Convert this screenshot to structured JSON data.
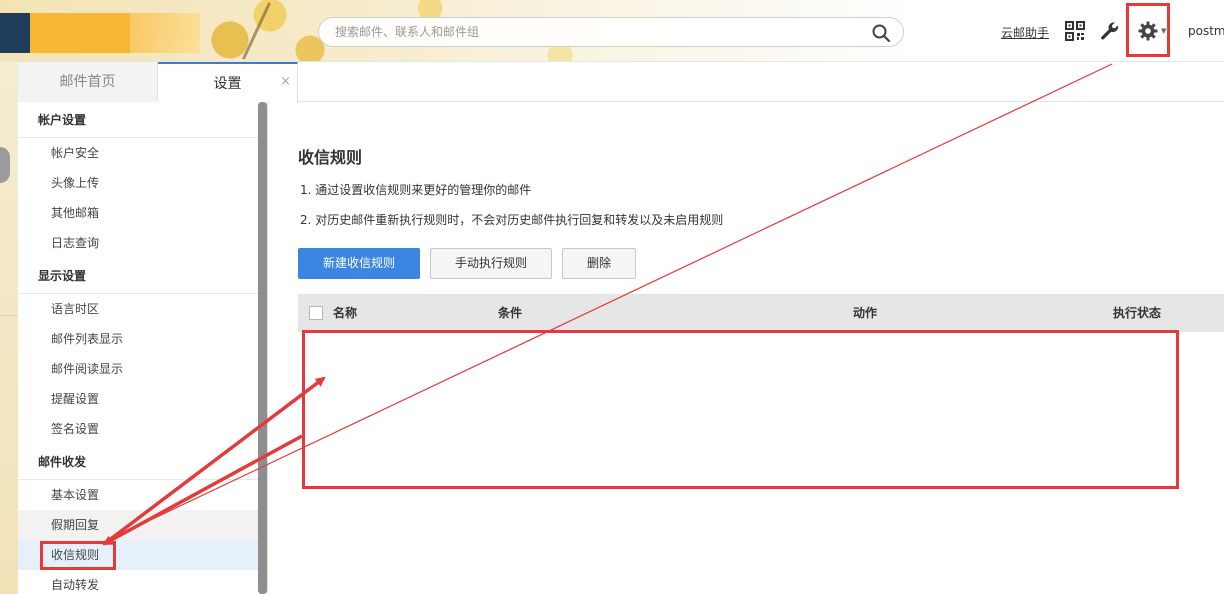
{
  "header": {
    "search_placeholder": "搜索邮件、联系人和邮件组",
    "helper_link": "云邮助手",
    "username": "postma"
  },
  "tabs": [
    {
      "label": "邮件首页"
    },
    {
      "label": "设置",
      "close": "×"
    }
  ],
  "sidebar": {
    "groups": [
      {
        "title": "帐户设置",
        "items": [
          "帐户安全",
          "头像上传",
          "其他邮箱",
          "日志查询"
        ]
      },
      {
        "title": "显示设置",
        "items": [
          "语言时区",
          "邮件列表显示",
          "邮件阅读显示",
          "提醒设置",
          "签名设置"
        ]
      },
      {
        "title": "邮件收发",
        "items": [
          "基本设置",
          "假期回复",
          "收信规则",
          "自动转发"
        ]
      }
    ],
    "active_item": "收信规则"
  },
  "main": {
    "title": "收信规则",
    "descriptions": [
      "1.  通过设置收信规则来更好的管理你的邮件",
      "2.  对历史邮件重新执行规则时，不会对历史邮件执行回复和转发以及未启用规则"
    ],
    "buttons": {
      "new_rule": "新建收信规则",
      "run_rule": "手动执行规则",
      "delete": "删除"
    },
    "table": {
      "columns": [
        "名称",
        "条件",
        "动作",
        "执行状态"
      ],
      "rows": []
    }
  },
  "colors": {
    "accent": "#3a86e0",
    "annotation": "#e63a3a"
  },
  "icons": [
    "search-icon",
    "qr-code-icon",
    "wrench-icon",
    "gear-icon"
  ]
}
